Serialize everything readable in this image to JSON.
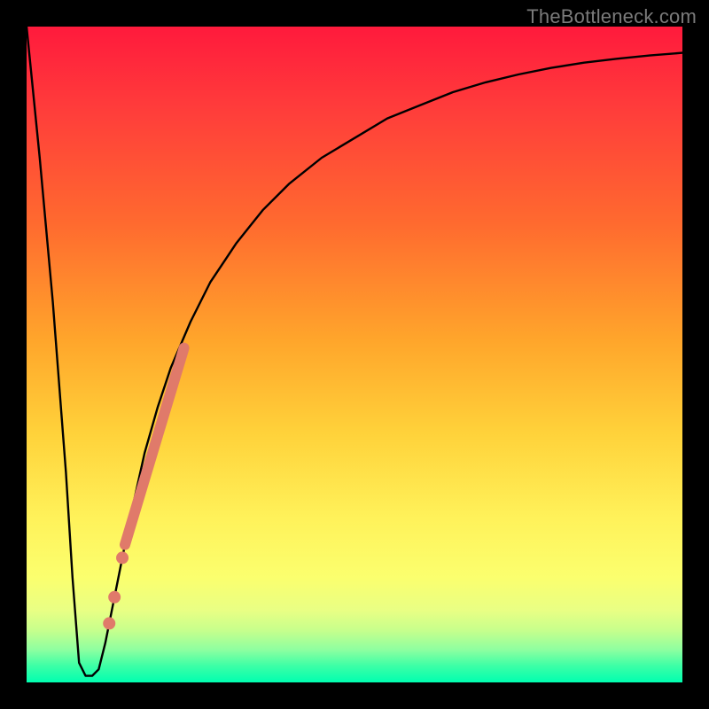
{
  "watermark": "TheBottleneck.com",
  "colors": {
    "frame": "#000000",
    "curve": "#000000",
    "highlight": "#e07a6a",
    "gradient_top": "#ff1a3c",
    "gradient_bottom": "#00ffb0"
  },
  "chart_data": {
    "type": "line",
    "title": "",
    "xlabel": "",
    "ylabel": "",
    "xlim": [
      0,
      100
    ],
    "ylim": [
      0,
      100
    ],
    "series": [
      {
        "name": "bottleneck-curve",
        "x": [
          0,
          2,
          4,
          6,
          7,
          8,
          9,
          10,
          11,
          12,
          14,
          16,
          18,
          20,
          22,
          25,
          28,
          32,
          36,
          40,
          45,
          50,
          55,
          60,
          65,
          70,
          75,
          80,
          85,
          90,
          95,
          100
        ],
        "y": [
          100,
          80,
          58,
          32,
          16,
          3,
          1,
          1,
          2,
          6,
          16,
          26,
          35,
          42,
          48,
          55,
          61,
          67,
          72,
          76,
          80,
          83,
          86,
          88,
          90,
          91.5,
          92.7,
          93.7,
          94.5,
          95.1,
          95.6,
          96
        ]
      }
    ],
    "highlight_segment": {
      "x": [
        15,
        24
      ],
      "y": [
        21,
        51
      ]
    },
    "highlight_points": [
      {
        "x": 14.6,
        "y": 19
      },
      {
        "x": 13.4,
        "y": 13
      },
      {
        "x": 12.6,
        "y": 9
      }
    ],
    "annotations": []
  }
}
